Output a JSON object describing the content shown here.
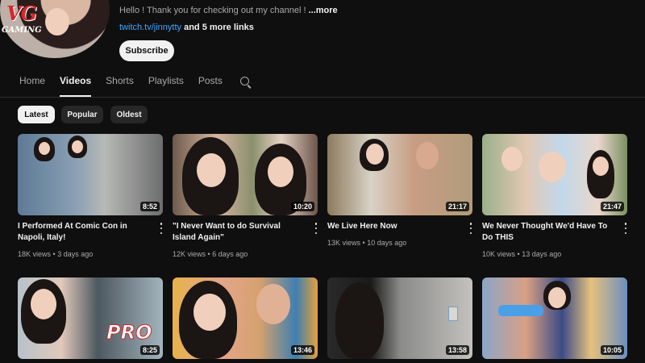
{
  "channel": {
    "description": "Hello ! Thank you for checking out my channel !",
    "more_label": "...more",
    "link_text": "twitch.tv/jinnytty",
    "more_links": "and 5 more links",
    "subscribe_label": "Subscribe",
    "logo_text": "VG",
    "logo_sub": "GAMING"
  },
  "tabs": [
    "Home",
    "Videos",
    "Shorts",
    "Playlists",
    "Posts"
  ],
  "active_tab": "Videos",
  "filters": [
    "Latest",
    "Popular",
    "Oldest"
  ],
  "active_filter": "Latest",
  "videos": [
    {
      "title": "I Performed At Comic Con in Napoli, Italy!",
      "views": "18K views",
      "age": "3 days ago",
      "duration": "8:52"
    },
    {
      "title": "\"I Never Want to do Survival Island Again\"",
      "views": "12K views",
      "age": "6 days ago",
      "duration": "10:20"
    },
    {
      "title": "We Live Here Now",
      "views": "13K views",
      "age": "10 days ago",
      "duration": "21:17"
    },
    {
      "title": "We Never Thought We'd Have To Do THIS",
      "views": "10K views",
      "age": "13 days ago",
      "duration": "21:47"
    },
    {
      "duration": "8:25",
      "overlay_text": "PRO"
    },
    {
      "duration": "13:46"
    },
    {
      "duration": "13:58"
    },
    {
      "duration": "10:05"
    }
  ],
  "meta_separator": "•",
  "icons": {
    "search": "search-icon",
    "menu": "more-vert-icon"
  }
}
